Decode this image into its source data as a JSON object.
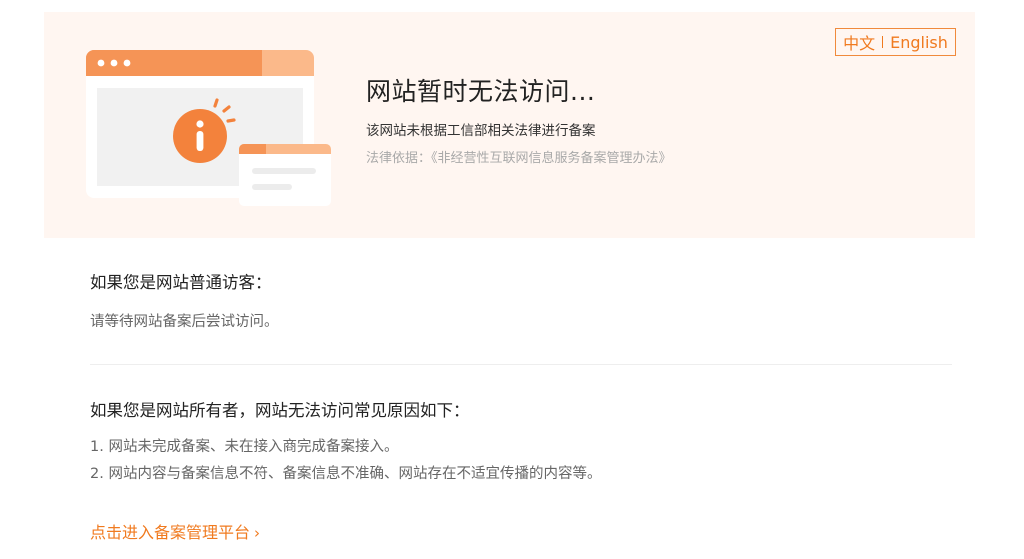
{
  "lang": {
    "zh": "中文",
    "en": "English"
  },
  "notice": {
    "title": "网站暂时无法访问...",
    "subtitle": "该网站未根据工信部相关法律进行备案",
    "law": "法律依据：《非经营性互联网信息服务备案管理办法》"
  },
  "visitor": {
    "heading": "如果您是网站普通访客：",
    "text": "请等待网站备案后尝试访问。"
  },
  "owner": {
    "heading": "如果您是网站所有者，网站无法访问常见原因如下：",
    "reasons": [
      "1. 网站未完成备案、未在接入商完成备案接入。",
      "2. 网站内容与备案信息不符、备案信息不准确、网站存在不适宜传播的内容等。"
    ]
  },
  "link": {
    "label": "点击进入备案管理平台",
    "chevron": "›"
  },
  "icons": {
    "illustration": "browser-info-icon",
    "chevron": "chevron-right-icon"
  },
  "colors": {
    "accent": "#f07a1f",
    "banner": "#fff6f1"
  }
}
